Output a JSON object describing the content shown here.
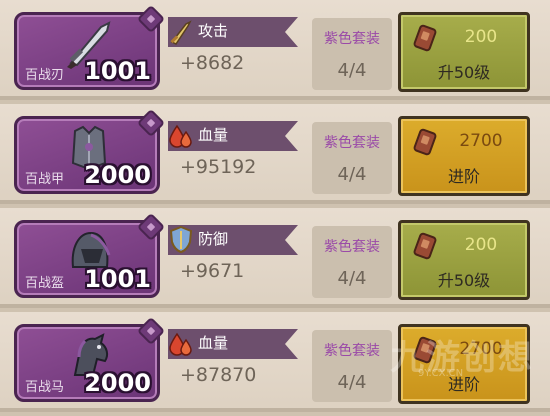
{
  "items": [
    {
      "name": "百战刃",
      "level": "1001",
      "art_icon": "blade-icon",
      "stat_icon": "sword-icon",
      "stat_label": "攻击",
      "stat_value": "+8682",
      "set_name": "紫色套装",
      "set_count": "4/4",
      "cost": "200",
      "action": "升50级",
      "button_style": "green"
    },
    {
      "name": "百战甲",
      "level": "2000",
      "art_icon": "armor-icon",
      "stat_icon": "blood-drop-icon",
      "stat_label": "血量",
      "stat_value": "+95192",
      "set_name": "紫色套装",
      "set_count": "4/4",
      "cost": "2700",
      "action": "进阶",
      "button_style": "gold"
    },
    {
      "name": "百战盔",
      "level": "1001",
      "art_icon": "helmet-icon",
      "stat_icon": "shield-icon",
      "stat_label": "防御",
      "stat_value": "+9671",
      "set_name": "紫色套装",
      "set_count": "4/4",
      "cost": "200",
      "action": "升50级",
      "button_style": "green"
    },
    {
      "name": "百战马",
      "level": "2000",
      "art_icon": "horse-icon",
      "stat_icon": "blood-drop-icon",
      "stat_label": "血量",
      "stat_value": "+87870",
      "set_name": "紫色套装",
      "set_count": "4/4",
      "cost": "2700",
      "action": "进阶",
      "button_style": "gold"
    }
  ],
  "cost_icon": "upgrade-token-icon",
  "watermark": {
    "text": "九游创想",
    "sub": "9Y.CX.CN"
  },
  "colors": {
    "card_purple": "#8f4f95",
    "set_purple": "#9a4aa8",
    "button_green": "#a7ad4b",
    "button_gold": "#dcac2c"
  }
}
